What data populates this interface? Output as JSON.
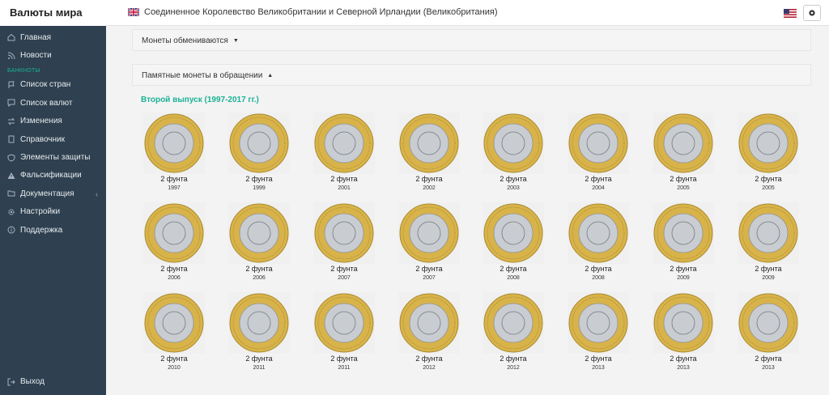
{
  "header": {
    "brand": "Валюты мира",
    "country": "Соединенное Королевство Великобритании и Северной Ирландии (Великобритания)"
  },
  "sidebar": {
    "items_top": [
      {
        "label": "Главная",
        "icon": "home-icon"
      },
      {
        "label": "Новости",
        "icon": "rss-icon"
      }
    ],
    "section": "БАНКНОТЫ",
    "items": [
      {
        "label": "Список стран",
        "icon": "flag-icon"
      },
      {
        "label": "Список валют",
        "icon": "chat-icon"
      },
      {
        "label": "Изменения",
        "icon": "exchange-icon"
      },
      {
        "label": "Справочник",
        "icon": "book-icon"
      },
      {
        "label": "Элементы защиты",
        "icon": "shield-icon"
      },
      {
        "label": "Фальсификации",
        "icon": "warning-icon"
      },
      {
        "label": "Документация",
        "icon": "folder-icon"
      },
      {
        "label": "Настройки",
        "icon": "gear-icon"
      },
      {
        "label": "Поддержка",
        "icon": "info-icon"
      }
    ],
    "logout": "Выход"
  },
  "panels": {
    "exchange": "Монеты обмениваются",
    "commemorative": "Памятные монеты в обращении"
  },
  "section_title": "Второй выпуск (1997-2017 гг.)",
  "coins": [
    {
      "name": "2 фунта",
      "year": "1997"
    },
    {
      "name": "2 фунта",
      "year": "1999"
    },
    {
      "name": "2 фунта",
      "year": "2001"
    },
    {
      "name": "2 фунта",
      "year": "2002"
    },
    {
      "name": "2 фунта",
      "year": "2003"
    },
    {
      "name": "2 фунта",
      "year": "2004"
    },
    {
      "name": "2 фунта",
      "year": "2005"
    },
    {
      "name": "2 фунта",
      "year": "2005"
    },
    {
      "name": "2 фунта",
      "year": "2006"
    },
    {
      "name": "2 фунта",
      "year": "2006"
    },
    {
      "name": "2 фунта",
      "year": "2007"
    },
    {
      "name": "2 фунта",
      "year": "2007"
    },
    {
      "name": "2 фунта",
      "year": "2008"
    },
    {
      "name": "2 фунта",
      "year": "2008"
    },
    {
      "name": "2 фунта",
      "year": "2009"
    },
    {
      "name": "2 фунта",
      "year": "2009"
    },
    {
      "name": "2 фунта",
      "year": "2010"
    },
    {
      "name": "2 фунта",
      "year": "2011"
    },
    {
      "name": "2 фунта",
      "year": "2011"
    },
    {
      "name": "2 фунта",
      "year": "2012"
    },
    {
      "name": "2 фунта",
      "year": "2012"
    },
    {
      "name": "2 фунта",
      "year": "2013"
    },
    {
      "name": "2 фунта",
      "year": "2013"
    },
    {
      "name": "2 фунта",
      "year": "2013"
    }
  ],
  "colors": {
    "sidebar_bg": "#2f4050",
    "accent": "#1ab394",
    "coin_outer": "#d8b34a",
    "coin_inner": "#c9cdd1"
  }
}
